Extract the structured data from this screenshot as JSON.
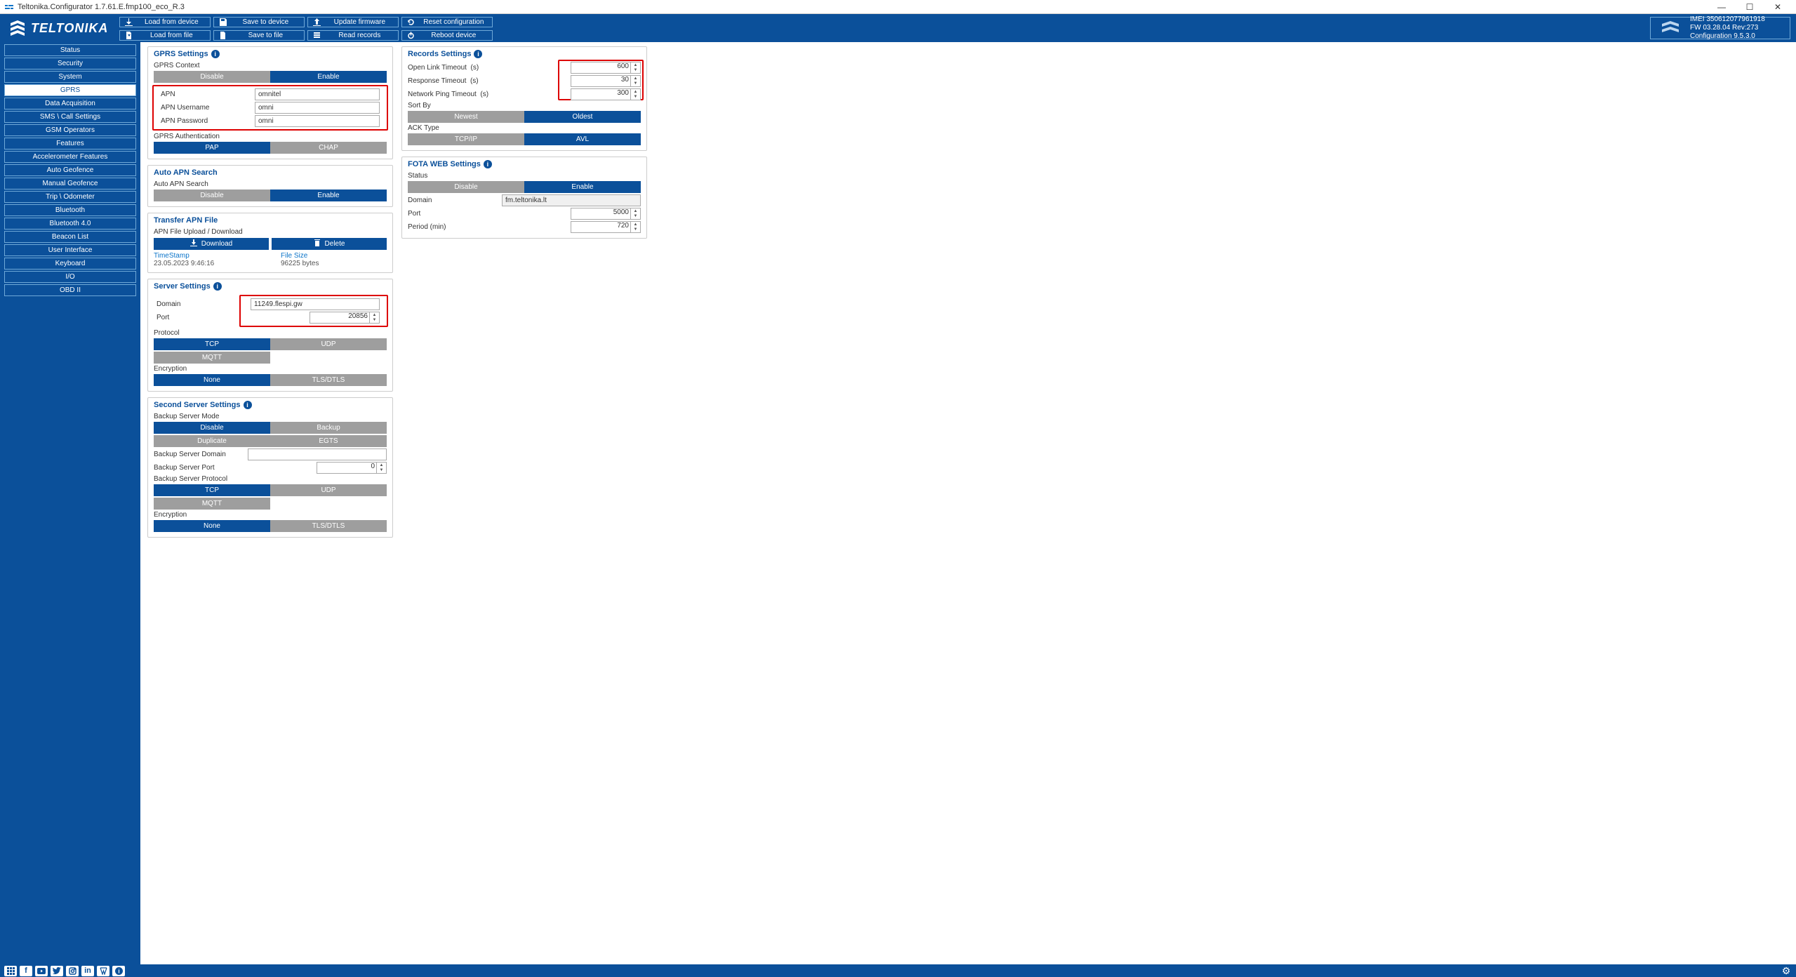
{
  "titlebar": {
    "title": "Teltonika.Configurator 1.7.61.E.fmp100_eco_R.3"
  },
  "header": {
    "logo_text": "TELTONIKA",
    "row1": {
      "load_device": "Load from device",
      "save_device": "Save to device",
      "update_fw": "Update firmware",
      "reset_cfg": "Reset configuration"
    },
    "row2": {
      "load_file": "Load from file",
      "save_file": "Save to file",
      "read_records": "Read records",
      "reboot": "Reboot device"
    },
    "devinfo": {
      "imei": "IMEI 350612077961918",
      "fw": "FW 03.28.04 Rev:273",
      "cfg": "Configuration 9.5.3.0"
    }
  },
  "sidebar": {
    "items": [
      "Status",
      "Security",
      "System",
      "GPRS",
      "Data Acquisition",
      "SMS \\ Call Settings",
      "GSM Operators",
      "Features",
      "Accelerometer Features",
      "Auto Geofence",
      "Manual Geofence",
      "Trip \\ Odometer",
      "Bluetooth",
      "Bluetooth 4.0",
      "Beacon List",
      "User Interface",
      "Keyboard",
      "I/O",
      "OBD II"
    ],
    "active_index": 3
  },
  "gprs_settings": {
    "title": "GPRS Settings",
    "context_label": "GPRS Context",
    "disable": "Disable",
    "enable": "Enable",
    "apn_label": "APN",
    "apn": "omnitel",
    "apn_user_label": "APN Username",
    "apn_user": "omni",
    "apn_pass_label": "APN Password",
    "apn_pass": "omni",
    "auth_label": "GPRS Authentication",
    "pap": "PAP",
    "chap": "CHAP"
  },
  "auto_apn": {
    "title": "Auto APN Search",
    "label": "Auto APN Search",
    "disable": "Disable",
    "enable": "Enable"
  },
  "transfer_apn": {
    "title": "Transfer APN File",
    "upload_label": "APN File Upload / Download",
    "download": "Download",
    "delete": "Delete",
    "ts_label": "TimeStamp",
    "ts": "23.05.2023 9:46:16",
    "size_label": "File Size",
    "size": "96225 bytes"
  },
  "server": {
    "title": "Server Settings",
    "domain_label": "Domain",
    "domain": "11249.flespi.gw",
    "port_label": "Port",
    "port": "20856",
    "proto_label": "Protocol",
    "tcp": "TCP",
    "udp": "UDP",
    "mqtt": "MQTT",
    "enc_label": "Encryption",
    "none": "None",
    "tls": "TLS/DTLS"
  },
  "second_server": {
    "title": "Second Server Settings",
    "mode_label": "Backup Server Mode",
    "disable": "Disable",
    "backup": "Backup",
    "duplicate": "Duplicate",
    "egts": "EGTS",
    "domain_label": "Backup Server Domain",
    "domain": "",
    "port_label": "Backup Server Port",
    "port": "0",
    "proto_label": "Backup Server Protocol",
    "tcp": "TCP",
    "udp": "UDP",
    "mqtt": "MQTT",
    "enc_label": "Encryption",
    "none": "None",
    "tls": "TLS/DTLS"
  },
  "records": {
    "title": "Records Settings",
    "open_link_label": "Open Link Timeout",
    "open_link_unit": "(s)",
    "open_link": "600",
    "resp_label": "Response Timeout",
    "resp_unit": "(s)",
    "resp": "30",
    "ping_label": "Network Ping Timeout",
    "ping_unit": "(s)",
    "ping": "300",
    "sort_label": "Sort By",
    "newest": "Newest",
    "oldest": "Oldest",
    "ack_label": "ACK Type",
    "tcpip": "TCP/IP",
    "avl": "AVL"
  },
  "fota": {
    "title": "FOTA WEB Settings",
    "status_label": "Status",
    "disable": "Disable",
    "enable": "Enable",
    "domain_label": "Domain",
    "domain": "fm.teltonika.lt",
    "port_label": "Port",
    "port": "5000",
    "period_label": "Period (min)",
    "period": "720"
  }
}
